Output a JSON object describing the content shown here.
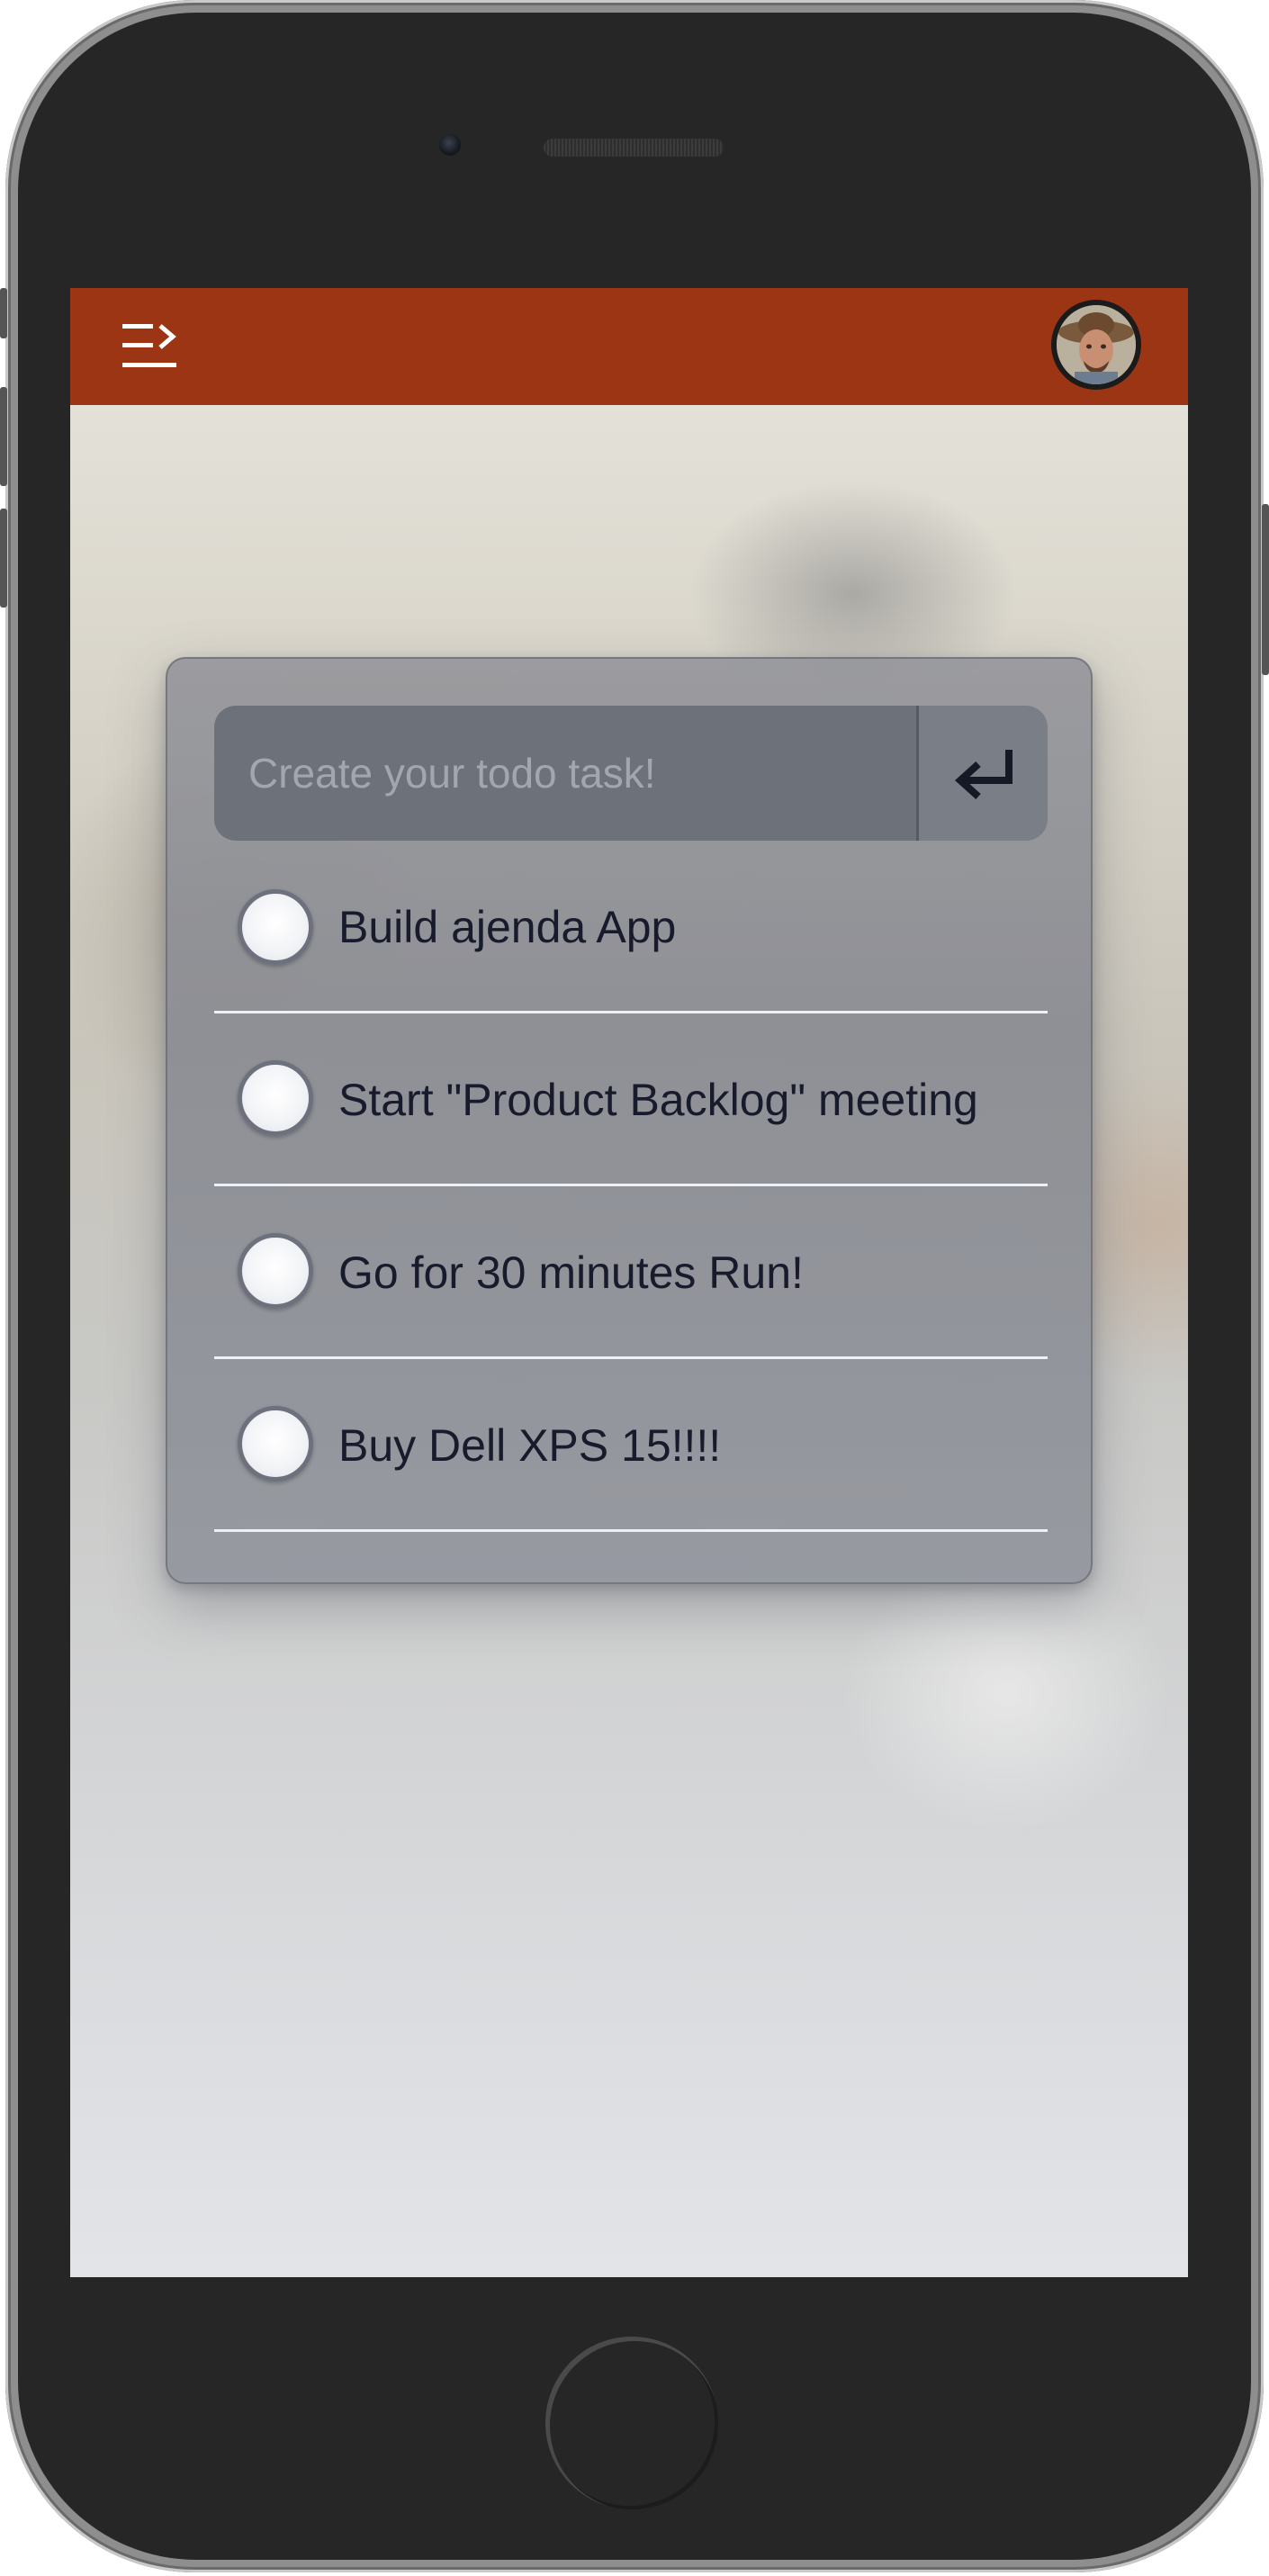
{
  "header": {
    "menu_icon": "menu-collapse-icon",
    "avatar_icon": "user-avatar",
    "bar_color": "#9c3514"
  },
  "todo": {
    "input_placeholder": "Create your todo task!",
    "input_value": "",
    "submit_icon": "return-arrow-icon",
    "items": [
      {
        "label": "Build ajenda App",
        "checked": false
      },
      {
        "label": "Start \"Product Backlog\" meeting",
        "checked": false
      },
      {
        "label": "Go for 30 minutes Run!",
        "checked": false
      },
      {
        "label": "Buy Dell XPS 15!!!!",
        "checked": false
      }
    ]
  }
}
